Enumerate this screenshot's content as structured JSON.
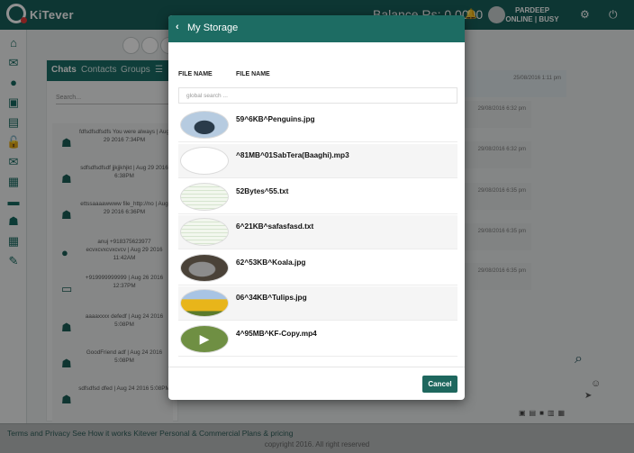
{
  "app": {
    "brand": "KiTever",
    "balance": "Balance Rs: 0.0000",
    "user_name": "PARDEEP",
    "user_status": "ONLINE | BUSY",
    "accent": "#1d6c63"
  },
  "chatpanel": {
    "tabs": [
      "Chats",
      "Contacts",
      "Groups"
    ],
    "search_placeholder": "Search...",
    "contacts": [
      "fdfsdfsdfsdfs You were always | Aug 29 2016 7:34PM",
      "sdfsdfsdfsdf jjkjjkhjkt | Aug 29 2016 6:38PM",
      "ettssaaaawwww file_http://no | Aug 29 2016 6:36PM",
      "anuj +918375623977 ecvxcvxcvxcvcv | Aug 29 2016 11:42AM",
      "+919999999999 | Aug 26 2016 12:37PM",
      "aaaaxxxx defedf | Aug 24 2016 5:08PM",
      "GoodFriend adf | Aug 24 2016 5:08PM",
      "sdfsdfsd dfed | Aug 24 2016 5:08PM"
    ]
  },
  "chat_times": [
    "25/08/2016 1:11 pm",
    "29/08/2016 6:32 pm",
    "29/08/2016 6:32 pm",
    "29/08/2016 6:35 pm",
    "29/08/2016 6:35 pm",
    "29/08/2016 6:35 pm"
  ],
  "footer": {
    "links": "Terms and Privacy   See How it works   Kitever Personal & Commercial   Plans & pricing",
    "copyright": "copyright 2016. All right reserved"
  },
  "modal": {
    "title": "My Storage",
    "col1": "FILE NAME",
    "col2": "FILE NAME",
    "search_placeholder": "global search ...",
    "files": [
      {
        "name": "59^6KB^Penguins.jpg",
        "thumb": "penguins"
      },
      {
        "name": "^81MB^01SabTera(Baaghi).mp3",
        "thumb": "blank"
      },
      {
        "name": "52Bytes^55.txt",
        "thumb": "text"
      },
      {
        "name": "6^21KB^safasfasd.txt",
        "thumb": "text"
      },
      {
        "name": "62^53KB^Koala.jpg",
        "thumb": "koala"
      },
      {
        "name": "06^34KB^Tulips.jpg",
        "thumb": "tulips"
      },
      {
        "name": "4^95MB^KF-Copy.mp4",
        "thumb": "video"
      }
    ],
    "cancel_label": "Cancel"
  }
}
